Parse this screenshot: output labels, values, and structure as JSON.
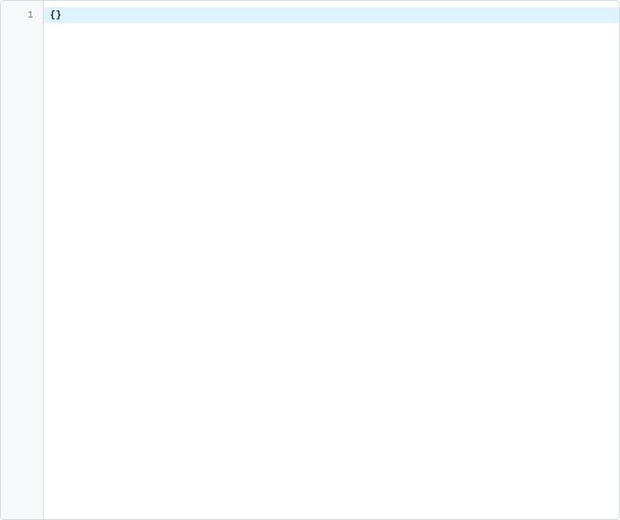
{
  "editor": {
    "lines": [
      {
        "number": "1",
        "content": "{}",
        "highlighted": true
      }
    ]
  }
}
